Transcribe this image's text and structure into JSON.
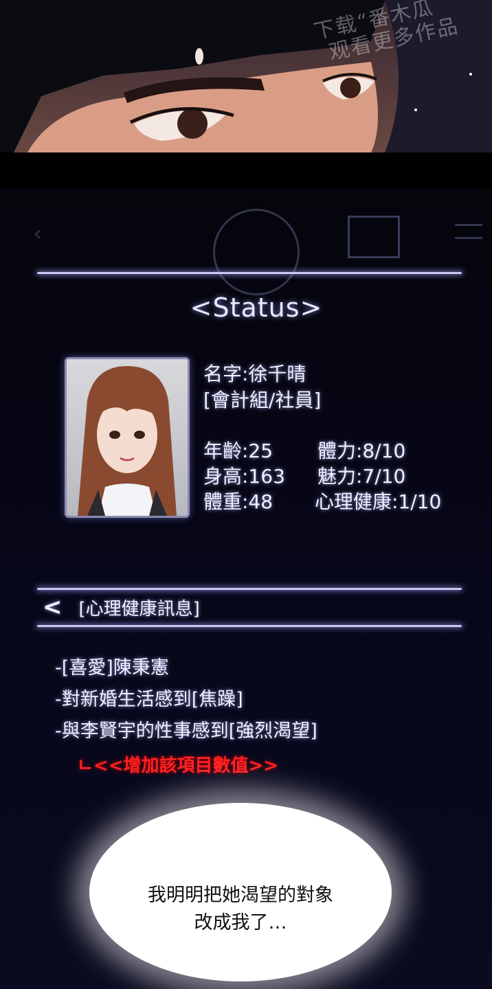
{
  "watermark": {
    "line1": "下载“番木瓜",
    "line2": "观看更多作品"
  },
  "status": {
    "title": "<Status>",
    "name": "名字:徐千晴",
    "dept": "[會計組/社員]",
    "age": "年齡:25",
    "height": "身高:163",
    "weight": "體重:48",
    "stamina": "體力:8/10",
    "charm": "魅力:7/10",
    "mental": "心理健康:1/10"
  },
  "section": {
    "title": "[心理健康訊息]",
    "items": [
      "-[喜愛]陳秉憲",
      "-對新婚生活感到[焦躁]",
      "-與李賢宇的性事感到[強烈渴望]"
    ],
    "action": "ㄴ<<增加該項目數值>>"
  },
  "bubble": {
    "line1": "我明明把她渴望的對象",
    "line2": "改成我了…"
  }
}
